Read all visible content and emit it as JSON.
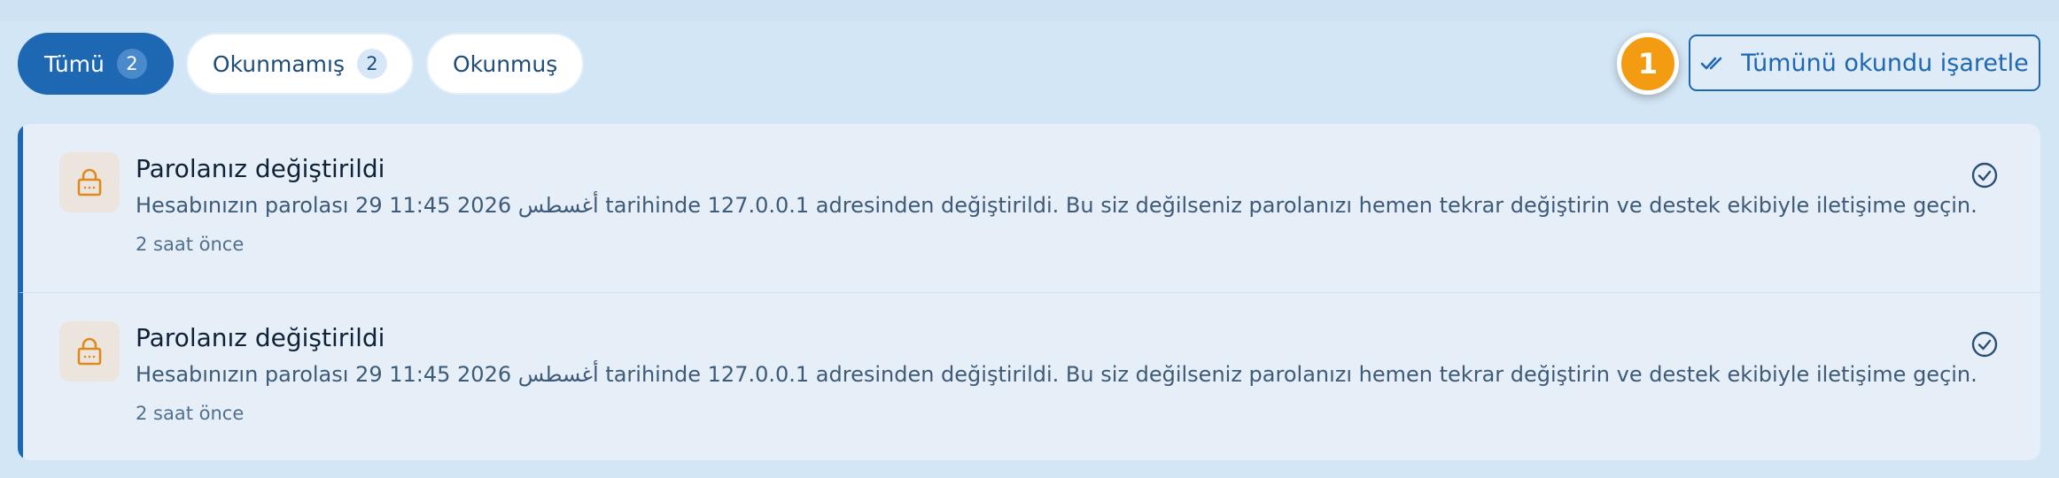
{
  "tabs": [
    {
      "label": "Tümü",
      "count": "2",
      "active": true
    },
    {
      "label": "Okunmamış",
      "count": "2",
      "active": false
    },
    {
      "label": "Okunmuş",
      "active": false
    }
  ],
  "step_badge": "1",
  "mark_all_label": "Tümünü okundu işaretle",
  "notifications": [
    {
      "icon": "lock-icon",
      "title": "Parolanız değiştirildi",
      "body": "Hesabınızın parolası 29 أغسطس 2026 11:45 tarihinde 127.0.0.1 adresinden değiştirildi. Bu siz değilseniz parolanızı hemen tekrar değiştirin ve destek ekibiyle iletişime geçin.",
      "time": "2 saat önce"
    },
    {
      "icon": "lock-icon",
      "title": "Parolanız değiştirildi",
      "body": "Hesabınızın parolası 29 أغسطس 2026 11:45 tarihinde 127.0.0.1 adresinden değiştirildi. Bu siz değilseniz parolanızı hemen tekrar değiştirin ve destek ekibiyle iletişime geçin.",
      "time": "2 saat önce"
    }
  ],
  "colors": {
    "primary": "#1e68b3",
    "accent_badge": "#f39c12",
    "lock_icon": "#e08a1e"
  }
}
